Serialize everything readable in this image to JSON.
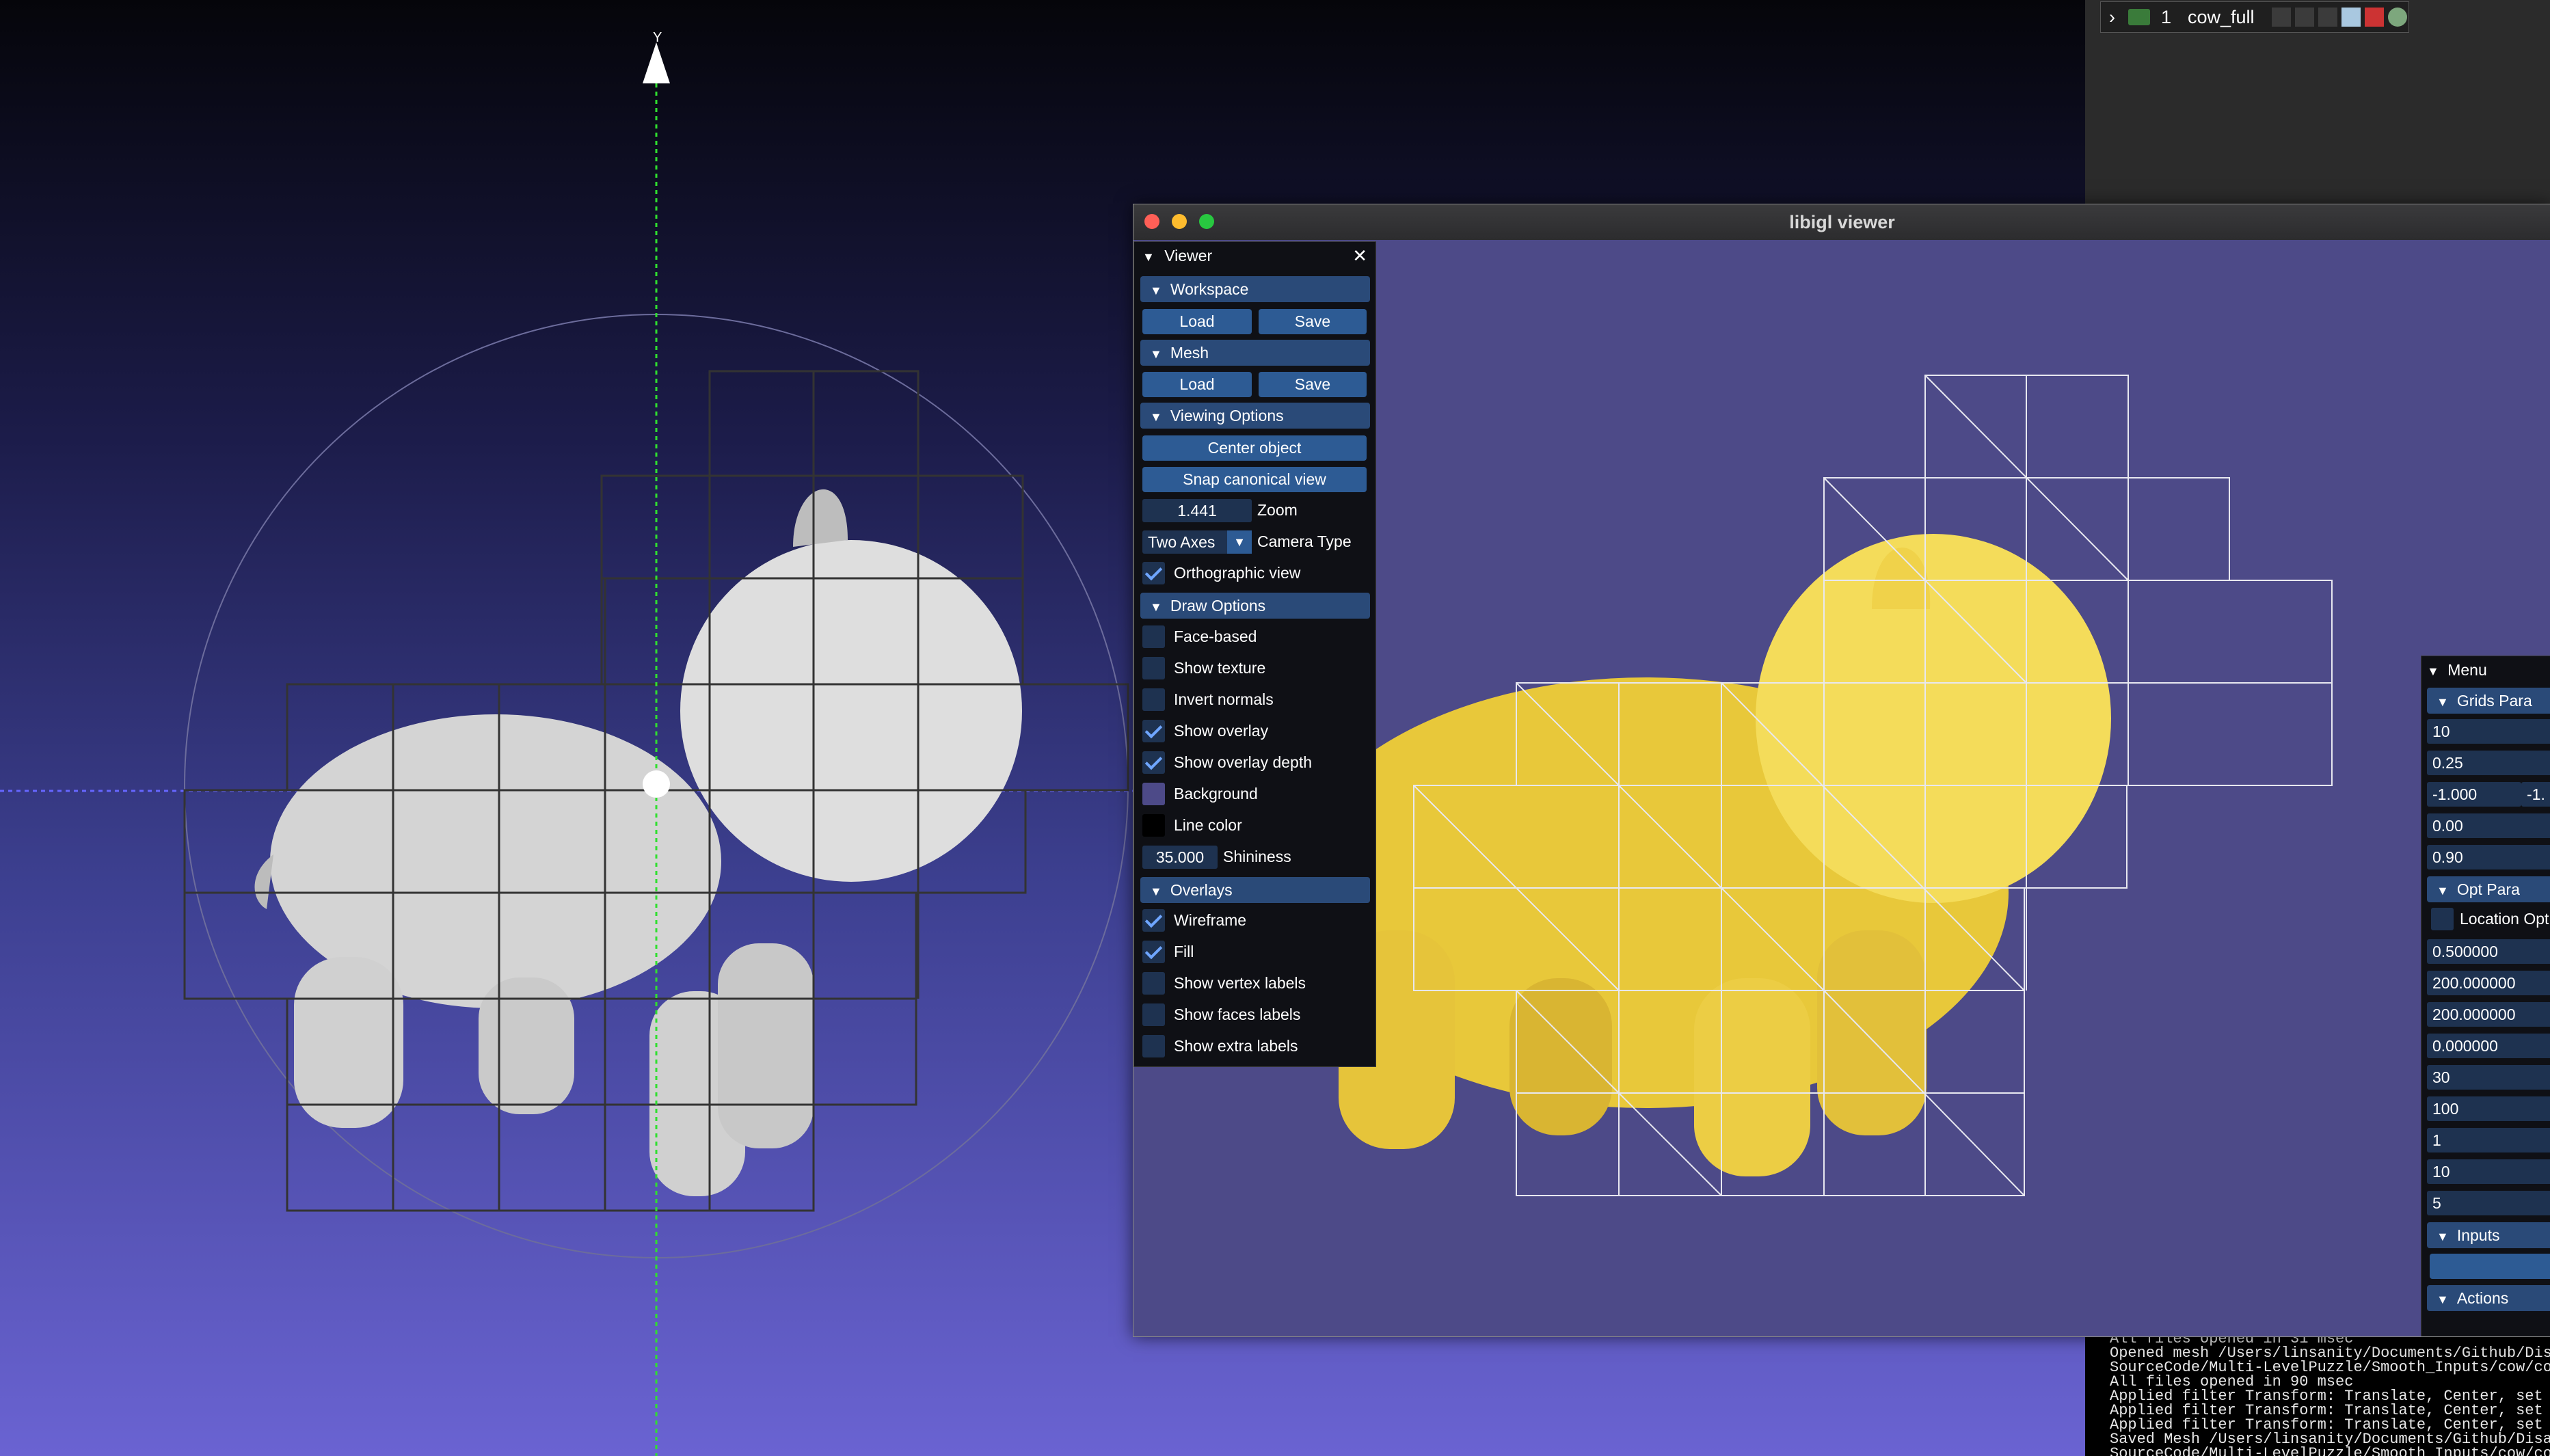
{
  "layer": {
    "index": "1",
    "name": "cow_full"
  },
  "left_axis_label": "Y",
  "igl": {
    "title": "libigl viewer",
    "viewer_panel": {
      "title": "Viewer",
      "workspace": {
        "header": "Workspace",
        "load": "Load",
        "save": "Save"
      },
      "mesh": {
        "header": "Mesh",
        "load": "Load",
        "save": "Save"
      },
      "viewing": {
        "header": "Viewing Options",
        "center": "Center object",
        "snap": "Snap canonical view",
        "zoom_value": "1.441",
        "zoom_label": "Zoom",
        "camera_value": "Two Axes",
        "camera_label": "Camera Type",
        "ortho_label": "Orthographic view"
      },
      "draw": {
        "header": "Draw Options",
        "face_based": "Face-based",
        "show_texture": "Show texture",
        "invert_normals": "Invert normals",
        "show_overlay": "Show overlay",
        "show_overlay_depth": "Show overlay depth",
        "background": "Background",
        "line_color": "Line color",
        "shininess_value": "35.000",
        "shininess_label": "Shininess"
      },
      "overlays": {
        "header": "Overlays",
        "wireframe": "Wireframe",
        "fill": "Fill",
        "vertex_labels": "Show vertex labels",
        "faces_labels": "Show faces labels",
        "extra_labels": "Show extra labels"
      }
    },
    "menu_panel": {
      "title": "Menu",
      "grids_header": "Grids Para",
      "grid_fields": [
        "10",
        "0.25",
        "-1.000",
        "0.00",
        "0.90"
      ],
      "grid_field_extra": "-1.",
      "opt_header": "Opt Para",
      "location_opt": "Location Opt",
      "opt_fields": [
        "0.500000",
        "200.000000",
        "200.000000",
        "0.000000",
        "30",
        "100",
        "1",
        "10",
        "5"
      ],
      "inputs_header": "Inputs",
      "actions_header": "Actions"
    }
  },
  "log_lines": [
    "All files opened in 31 msec",
    "Opened mesh /Users/linsanity/Documents/Github/Disassem",
    "SourceCode/Multi-LevelPuzzle/Smooth_Inputs/cow/cow_fu",
    "All files opened in 90 msec",
    "Applied filter Transform: Translate, Center, set Orig",
    "Applied filter Transform: Translate, Center, set Orig",
    "Applied filter Transform: Translate, Center, set Orig",
    "Saved Mesh /Users/linsanity/Documents/Github/Disassemb",
    "SourceCode/Multi-LevelPuzzle/Smooth_Inputs/cow/cow_fu"
  ],
  "colors": {
    "mesh_yellow": "#f4dc5a",
    "mesh_gray": "#d0d0d0",
    "accent_blue": "#2d5b94"
  }
}
